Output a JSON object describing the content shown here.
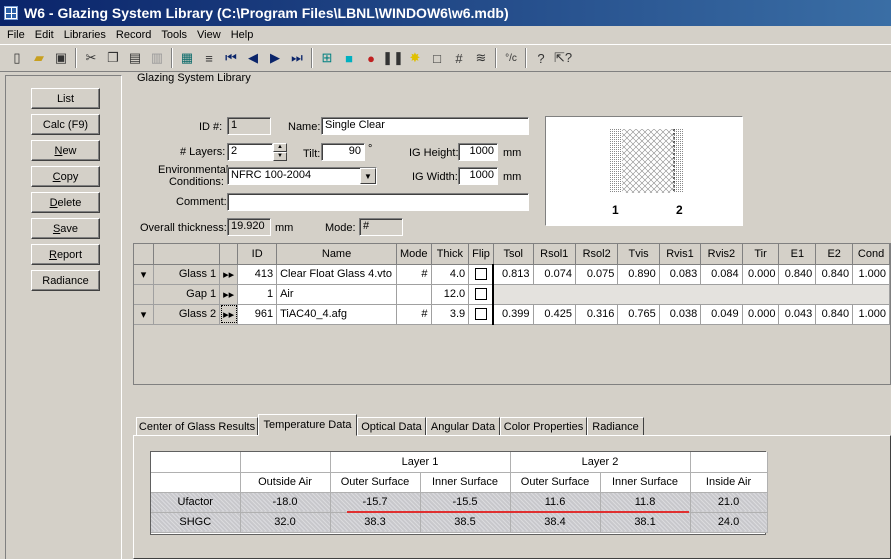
{
  "window": {
    "title": "W6 - Glazing System Library (C:\\Program Files\\LBNL\\WINDOW6\\w6.mdb)"
  },
  "menu": [
    "File",
    "Edit",
    "Libraries",
    "Record",
    "Tools",
    "View",
    "Help"
  ],
  "toolbar_icons": [
    "new-icon",
    "open-icon",
    "save-icon",
    "cut-icon",
    "copy-icon",
    "paste-icon",
    "print-icon",
    "grid-view-icon",
    "detail-view-icon",
    "first-record-icon",
    "prev-record-icon",
    "next-record-icon",
    "last-record-icon",
    "frame-icon",
    "glass-icon",
    "bulb-icon",
    "pause-icon",
    "sun-icon",
    "square-icon",
    "hash-icon",
    "spring-icon",
    "unit-convert-icon",
    "help-icon",
    "context-help-icon"
  ],
  "sidebar": {
    "buttons": [
      {
        "label": "List",
        "ul": ""
      },
      {
        "label": "Calc (F9)",
        "ul": ""
      },
      {
        "label": "New",
        "ul": "N"
      },
      {
        "label": "Copy",
        "ul": "C"
      },
      {
        "label": "Delete",
        "ul": "D"
      },
      {
        "label": "Save",
        "ul": "S"
      },
      {
        "label": "Report",
        "ul": "R"
      },
      {
        "label": "Radiance",
        "ul": ""
      }
    ]
  },
  "form": {
    "caption": "Glazing System Library",
    "id_label": "ID #:",
    "id_value": "1",
    "name_label": "Name:",
    "name_value": "Single Clear",
    "layers_label": "# Layers:",
    "layers_value": "2",
    "tilt_label": "Tilt:",
    "tilt_value": "90",
    "tilt_unit": "°",
    "ig_height_label": "IG Height:",
    "ig_height_value": "1000",
    "ig_height_unit": "mm",
    "env_label_1": "Environmental",
    "env_label_2": "Conditions:",
    "env_value": "NFRC 100-2004",
    "ig_width_label": "IG Width:",
    "ig_width_value": "1000",
    "ig_width_unit": "mm",
    "comment_label": "Comment:",
    "comment_value": "",
    "thickness_label": "Overall thickness:",
    "thickness_value": "19.920",
    "thickness_unit": "mm",
    "mode_label": "Mode:",
    "mode_value": "#"
  },
  "preview": {
    "label_left": "1",
    "label_right": "2"
  },
  "layers_table": {
    "columns": [
      "ID",
      "Name",
      "Mode",
      "Thick",
      "Flip",
      "Tsol",
      "Rsol1",
      "Rsol2",
      "Tvis",
      "Rvis1",
      "Rvis2",
      "Tir",
      "E1",
      "E2",
      "Cond"
    ],
    "rows": [
      {
        "row": "Glass 1",
        "id": "413",
        "name": "Clear Float Glass 4.vto",
        "mode": "#",
        "thick": "4.0",
        "tsol": "0.813",
        "rsol1": "0.074",
        "rsol2": "0.075",
        "tvis": "0.890",
        "rvis1": "0.083",
        "rvis2": "0.084",
        "tir": "0.000",
        "e1": "0.840",
        "e2": "0.840",
        "cond": "1.000"
      },
      {
        "row": "Gap 1",
        "id": "1",
        "name": "Air",
        "mode": "",
        "thick": "12.0"
      },
      {
        "row": "Glass 2",
        "id": "961",
        "name": "TiAC40_4.afg",
        "mode": "#",
        "thick": "3.9",
        "tsol": "0.399",
        "rsol1": "0.425",
        "rsol2": "0.316",
        "tvis": "0.765",
        "rvis1": "0.038",
        "rvis2": "0.049",
        "tir": "0.000",
        "e1": "0.043",
        "e2": "0.840",
        "cond": "1.000"
      }
    ]
  },
  "tabs": [
    "Center of Glass Results",
    "Temperature Data",
    "Optical Data",
    "Angular Data",
    "Color Properties",
    "Radiance"
  ],
  "active_tab": "Temperature Data",
  "temperature": {
    "group_headers": [
      "Layer 1",
      "Layer 2"
    ],
    "columns": [
      "Outside Air",
      "Outer Surface",
      "Inner Surface",
      "Outer Surface",
      "Inner Surface",
      "Inside Air"
    ],
    "rows": [
      {
        "label": "Ufactor",
        "values": [
          "-18.0",
          "-15.7",
          "-15.5",
          "11.6",
          "11.8",
          "21.0"
        ]
      },
      {
        "label": "SHGC",
        "values": [
          "32.0",
          "38.3",
          "38.5",
          "38.4",
          "38.1",
          "24.0"
        ]
      }
    ]
  },
  "colors": {
    "titlebar": "#0a246a",
    "face": "#d4d0c8",
    "highlight": "#e03030"
  }
}
